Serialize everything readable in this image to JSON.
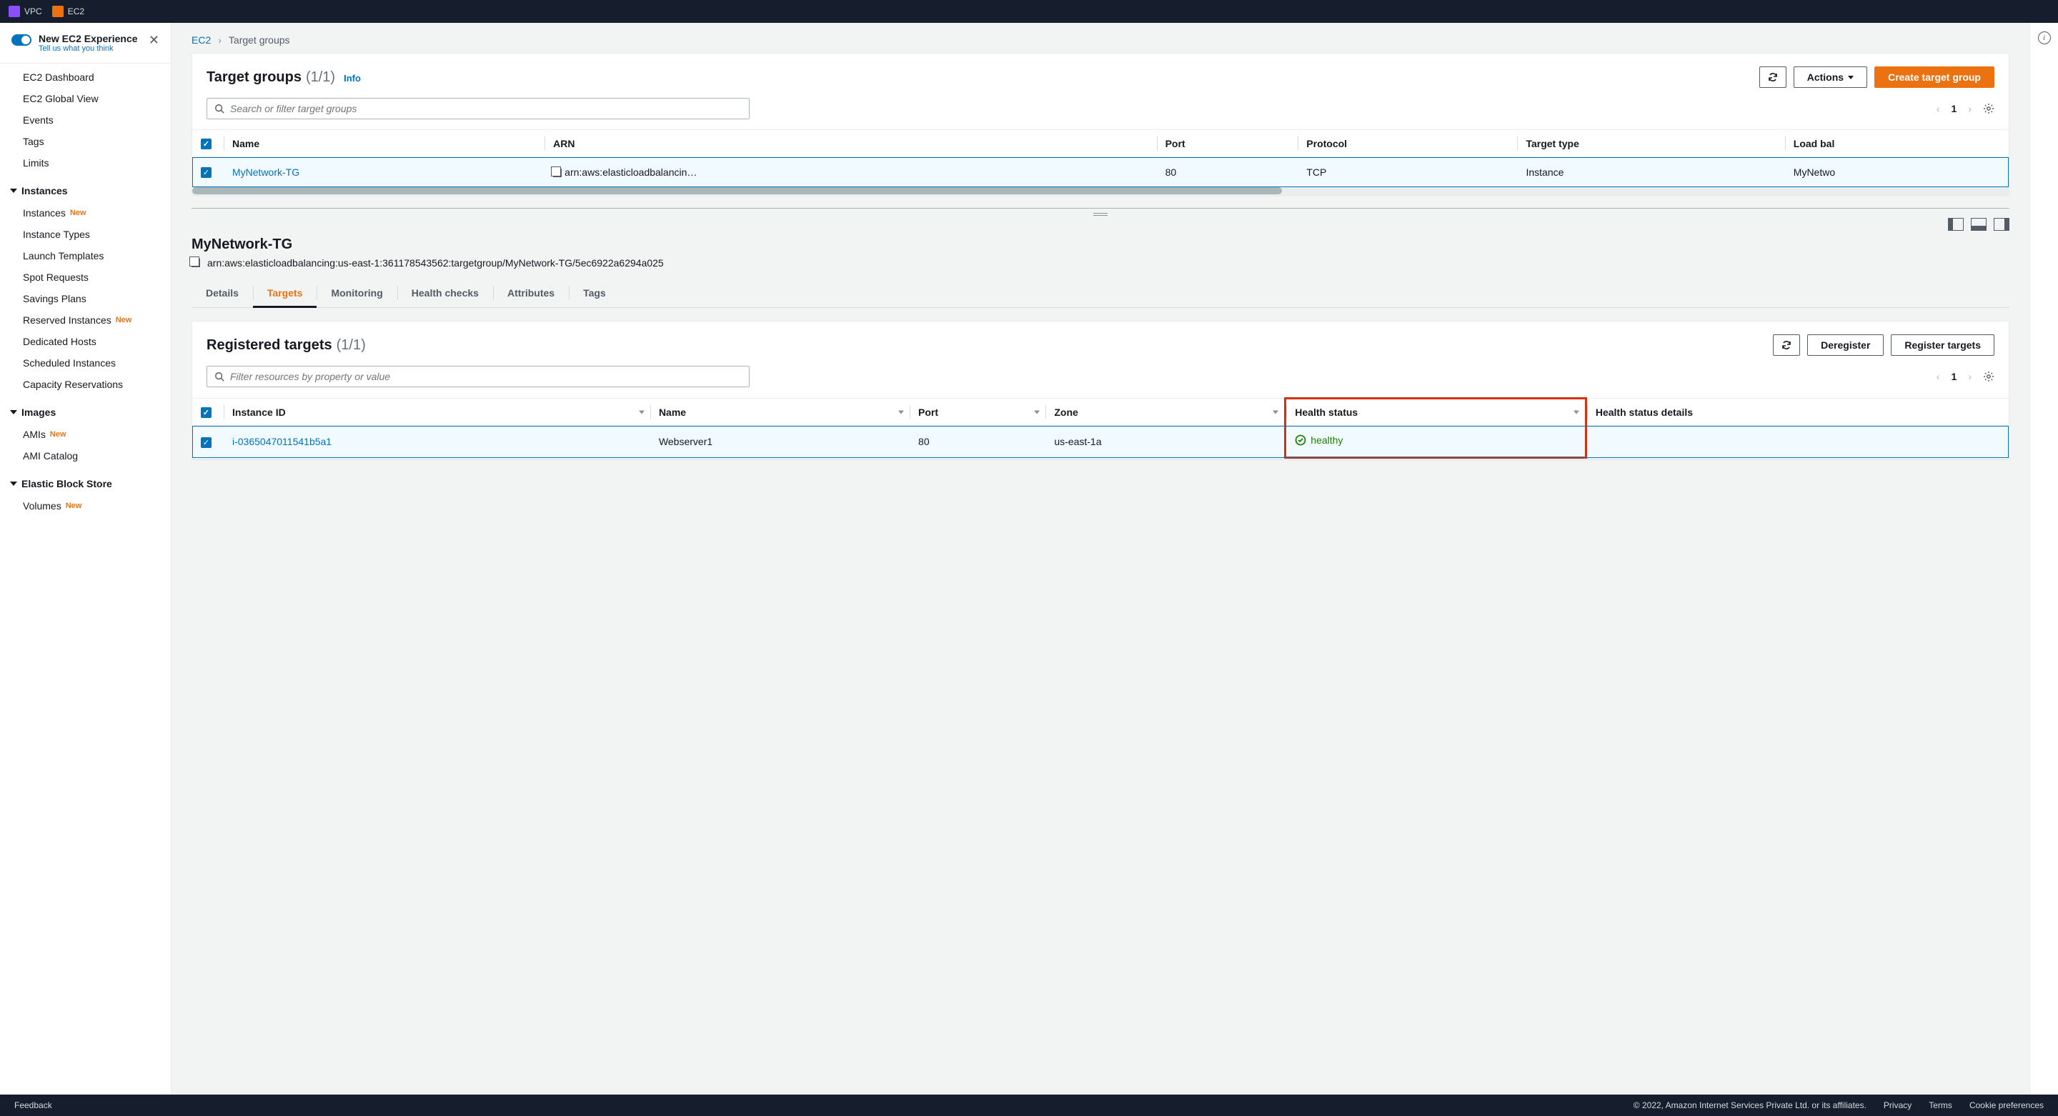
{
  "topnav": {
    "vpc": "VPC",
    "ec2": "EC2"
  },
  "sidebar": {
    "experience_title": "New EC2 Experience",
    "experience_sub": "Tell us what you think",
    "top_links": [
      "EC2 Dashboard",
      "EC2 Global View",
      "Events",
      "Tags",
      "Limits"
    ],
    "groups": [
      {
        "title": "Instances",
        "items": [
          {
            "label": "Instances",
            "new": true
          },
          {
            "label": "Instance Types"
          },
          {
            "label": "Launch Templates"
          },
          {
            "label": "Spot Requests"
          },
          {
            "label": "Savings Plans"
          },
          {
            "label": "Reserved Instances",
            "new": true
          },
          {
            "label": "Dedicated Hosts"
          },
          {
            "label": "Scheduled Instances"
          },
          {
            "label": "Capacity Reservations"
          }
        ]
      },
      {
        "title": "Images",
        "items": [
          {
            "label": "AMIs",
            "new": true
          },
          {
            "label": "AMI Catalog"
          }
        ]
      },
      {
        "title": "Elastic Block Store",
        "items": [
          {
            "label": "Volumes",
            "new": true
          }
        ]
      }
    ],
    "new_badge": "New"
  },
  "breadcrumb": {
    "root": "EC2",
    "current": "Target groups"
  },
  "tg_panel": {
    "title": "Target groups",
    "count": "(1/1)",
    "info": "Info",
    "actions_label": "Actions",
    "create_label": "Create target group",
    "search_placeholder": "Search or filter target groups",
    "page": "1",
    "columns": [
      "Name",
      "ARN",
      "Port",
      "Protocol",
      "Target type",
      "Load bal"
    ],
    "row": {
      "name": "MyNetwork-TG",
      "arn": "arn:aws:elasticloadbalancin…",
      "port": "80",
      "protocol": "TCP",
      "target_type": "Instance",
      "lb": "MyNetwo"
    }
  },
  "detail": {
    "name": "MyNetwork-TG",
    "arn": "arn:aws:elasticloadbalancing:us-east-1:361178543562:targetgroup/MyNetwork-TG/5ec6922a6294a025",
    "tabs": [
      "Details",
      "Targets",
      "Monitoring",
      "Health checks",
      "Attributes",
      "Tags"
    ],
    "active_tab": 1
  },
  "targets_panel": {
    "title": "Registered targets",
    "count": "(1/1)",
    "deregister": "Deregister",
    "register": "Register targets",
    "search_placeholder": "Filter resources by property or value",
    "page": "1",
    "columns": [
      "Instance ID",
      "Name",
      "Port",
      "Zone",
      "Health status",
      "Health status details"
    ],
    "row": {
      "instance_id": "i-0365047011541b5a1",
      "name": "Webserver1",
      "port": "80",
      "zone": "us-east-1a",
      "health": "healthy",
      "details": ""
    }
  },
  "footer": {
    "feedback": "Feedback",
    "copyright": "© 2022, Amazon Internet Services Private Ltd. or its affiliates.",
    "privacy": "Privacy",
    "terms": "Terms",
    "cookies": "Cookie preferences"
  }
}
